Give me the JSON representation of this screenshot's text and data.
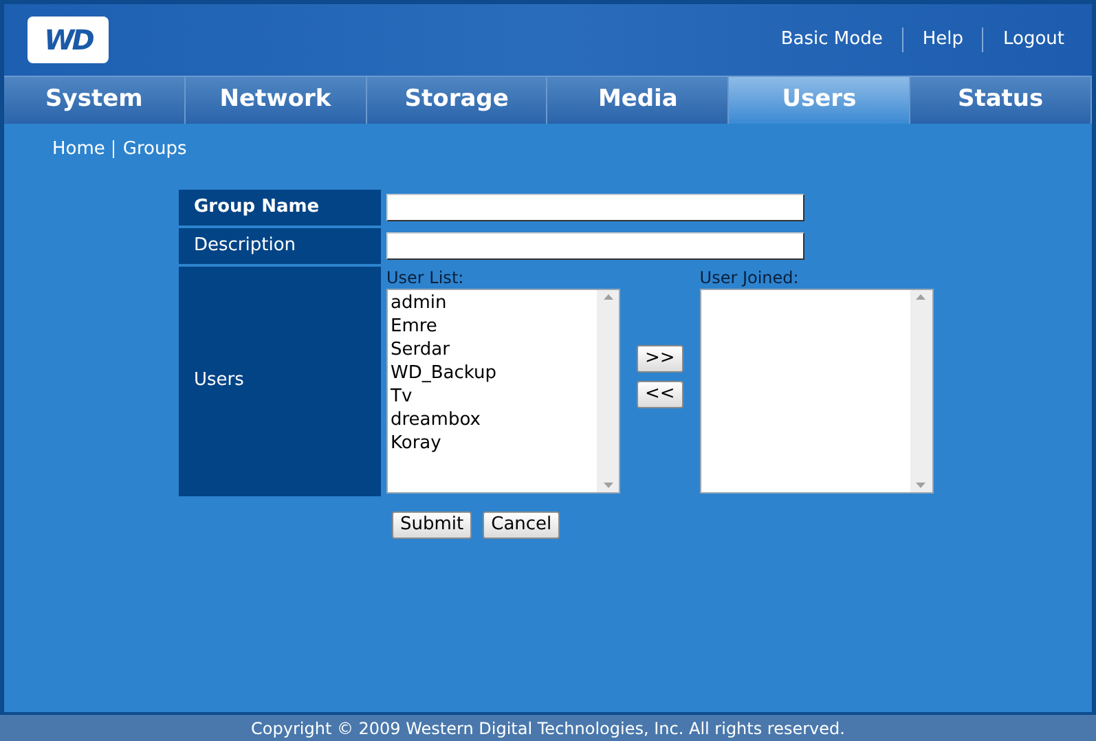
{
  "logo": {
    "text": "WD"
  },
  "top_links": [
    "Basic Mode",
    "Help",
    "Logout"
  ],
  "tabs": [
    {
      "label": "System",
      "selected": false
    },
    {
      "label": "Network",
      "selected": false
    },
    {
      "label": "Storage",
      "selected": false
    },
    {
      "label": "Media",
      "selected": false
    },
    {
      "label": "Users",
      "selected": true
    },
    {
      "label": "Status",
      "selected": false
    }
  ],
  "breadcrumb": [
    "Home",
    "Groups"
  ],
  "form": {
    "fields": [
      {
        "label": "Group Name",
        "bold": true
      },
      {
        "label": "Description",
        "bold": false
      }
    ],
    "users": {
      "label": "Users",
      "user_list_label": "User List:",
      "user_list": [
        "admin",
        "Emre",
        "Serdar",
        "WD_Backup",
        "Tv",
        "dreambox",
        "Koray"
      ],
      "add_button": ">>",
      "remove_button": "<<",
      "joined_label": "User Joined:"
    },
    "buttons": [
      "Submit",
      "Cancel"
    ]
  },
  "footer": "Copyright © 2009 Western Digital Technologies, Inc. All rights reserved."
}
